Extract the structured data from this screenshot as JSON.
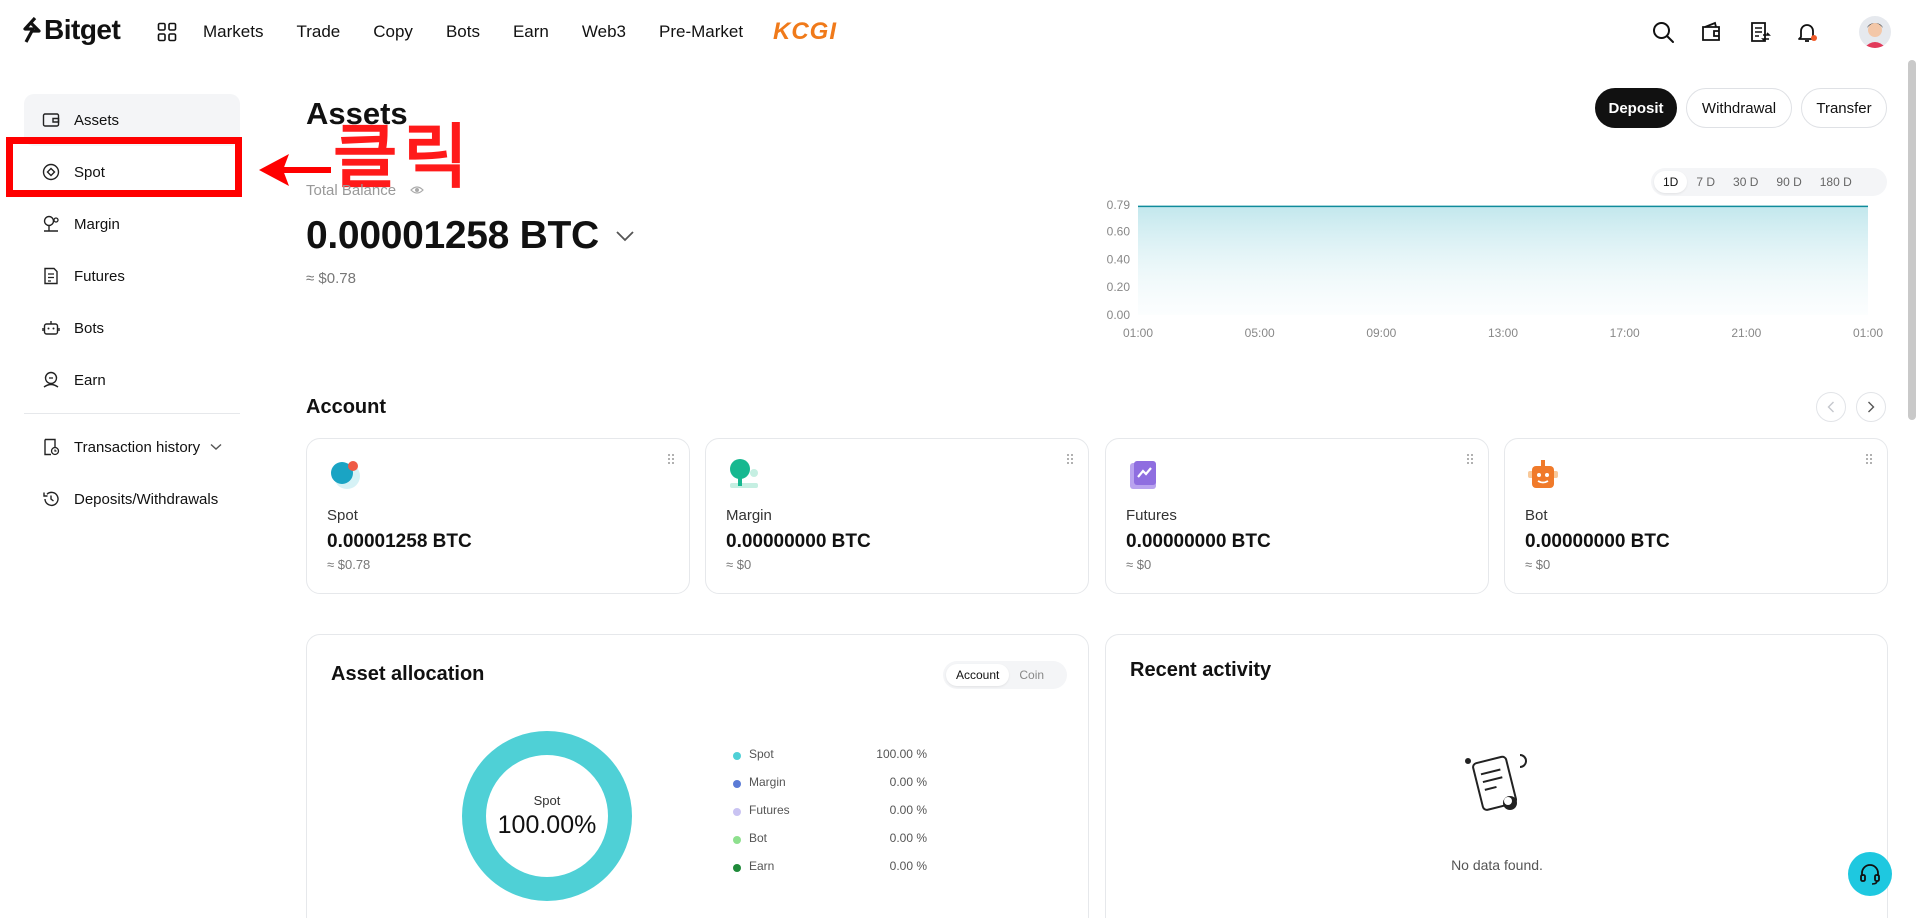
{
  "nav": {
    "brand": "Bitget",
    "links": [
      "Markets",
      "Trade",
      "Copy",
      "Bots",
      "Earn",
      "Web3",
      "Pre-Market"
    ],
    "promo": "KCGI"
  },
  "sidebar": {
    "items": [
      {
        "label": "Assets",
        "icon": "wallet-icon"
      },
      {
        "label": "Spot",
        "icon": "spot-icon"
      },
      {
        "label": "Margin",
        "icon": "margin-icon"
      },
      {
        "label": "Futures",
        "icon": "futures-icon"
      },
      {
        "label": "Bots",
        "icon": "bot-icon"
      },
      {
        "label": "Earn",
        "icon": "earn-icon"
      }
    ],
    "history": [
      {
        "label": "Transaction history",
        "icon": "history-doc-icon"
      },
      {
        "label": "Deposits/Withdrawals",
        "icon": "clock-back-icon"
      }
    ]
  },
  "annotation": {
    "text": "클릭",
    "color": "#ff0000"
  },
  "header": {
    "title": "Assets",
    "deposit": "Deposit",
    "withdrawal": "Withdrawal",
    "transfer": "Transfer"
  },
  "balance": {
    "label": "Total Balance",
    "value": "0.00001258 BTC",
    "usd": "≈ $0.78"
  },
  "range": {
    "options": [
      "1D",
      "7 D",
      "30 D",
      "90 D",
      "180 D"
    ],
    "selected": "1D"
  },
  "chart_data": {
    "type": "area",
    "x": [
      "01:00",
      "05:00",
      "09:00",
      "13:00",
      "17:00",
      "21:00",
      "01:00"
    ],
    "values": [
      0.78,
      0.78,
      0.78,
      0.78,
      0.78,
      0.78,
      0.78
    ],
    "y_ticks": [
      "0.79",
      "0.60",
      "0.40",
      "0.20",
      "0.00"
    ],
    "ylim": [
      0,
      0.79
    ],
    "color": "#0f8b9b",
    "title": "",
    "grid": false
  },
  "account": {
    "title": "Account",
    "cards": [
      {
        "name": "Spot",
        "value": "0.00001258 BTC",
        "usd": "≈ $0.78"
      },
      {
        "name": "Margin",
        "value": "0.00000000 BTC",
        "usd": "≈ $0"
      },
      {
        "name": "Futures",
        "value": "0.00000000 BTC",
        "usd": "≈ $0"
      },
      {
        "name": "Bot",
        "value": "0.00000000 BTC",
        "usd": "≈ $0"
      }
    ]
  },
  "allocation": {
    "title": "Asset allocation",
    "tabs": [
      "Account",
      "Coin"
    ],
    "donut_label": "Spot",
    "donut_pct": "100.00%",
    "legend": [
      {
        "name": "Spot",
        "pct": "100.00 %",
        "color": "#4fd0d6",
        "value": 100
      },
      {
        "name": "Margin",
        "pct": "0.00 %",
        "color": "#5b7bd6",
        "value": 0
      },
      {
        "name": "Futures",
        "pct": "0.00 %",
        "color": "#c9c3f2",
        "value": 0
      },
      {
        "name": "Bot",
        "pct": "0.00 %",
        "color": "#8ee08e",
        "value": 0
      },
      {
        "name": "Earn",
        "pct": "0.00 %",
        "color": "#1f8a3a",
        "value": 0
      }
    ]
  },
  "recent": {
    "title": "Recent activity",
    "empty": "No data found."
  }
}
